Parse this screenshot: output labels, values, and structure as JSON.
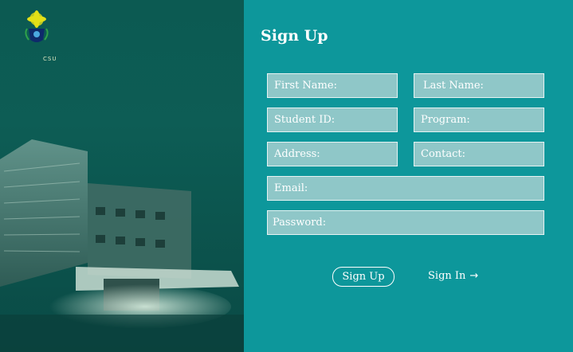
{
  "brand": {
    "logo_text": "CSU"
  },
  "form": {
    "title": "Sign Up",
    "first_name_placeholder": "First Name:",
    "last_name_placeholder": "Last Name:",
    "student_id_placeholder": "Student ID:",
    "program_placeholder": "Program:",
    "address_placeholder": "Address:",
    "contact_placeholder": "Contact:",
    "email_placeholder": "Email:",
    "password_placeholder": "Password:",
    "signup_button": "Sign Up",
    "signin_link": "Sign In",
    "signin_icon": "arrow-right-icon"
  },
  "colors": {
    "panel_bg": "#0d979b",
    "field_bg": "#8fc7c8",
    "overlay": "#0c5a52"
  }
}
